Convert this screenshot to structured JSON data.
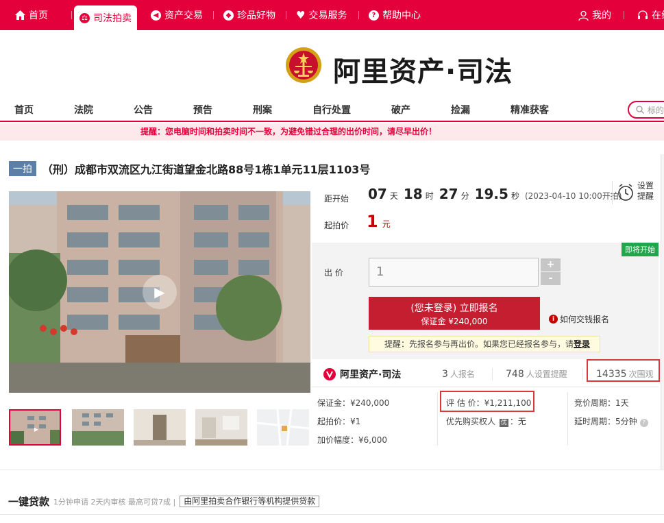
{
  "topbar": {
    "items": [
      {
        "label": "首页",
        "icon": "home-icon"
      },
      {
        "label": "司法拍卖",
        "icon": "gavel-icon"
      },
      {
        "label": "资产交易",
        "icon": "compass-icon"
      },
      {
        "label": "珍品好物",
        "icon": "gem-icon"
      },
      {
        "label": "交易服务",
        "icon": "heart-icon"
      },
      {
        "label": "帮助中心",
        "icon": "question-icon"
      }
    ],
    "mine": "我的",
    "online": "在线"
  },
  "logo": {
    "text": "阿里资产·司法"
  },
  "nav": {
    "items": [
      "首页",
      "法院",
      "公告",
      "预告",
      "刑案",
      "自行处置",
      "破产",
      "捡漏",
      "精准获客"
    ],
    "search_placeholder": "标的"
  },
  "notice": "提醒：您电脑时间和拍卖时间不一致，为避免错过合理的出价时间，请尽早出价！",
  "lot": {
    "tag": "一拍",
    "title": "（刑）成都市双流区九江街道望金北路88号1栋1单元11层1103号"
  },
  "countdown": {
    "label": "距开始",
    "days": "07",
    "days_unit": "天",
    "hours": "18",
    "hours_unit": "时",
    "minutes": "27",
    "minutes_unit": "分",
    "seconds": "19.5",
    "seconds_unit": "秒",
    "start": "(2023-04-10 10:00开拍)"
  },
  "remind": {
    "line1": "设置",
    "line2": "提醒"
  },
  "start_price": {
    "label": "起拍价",
    "value": "1",
    "unit": "元"
  },
  "bid": {
    "badge": "即将开始",
    "label": "出 价",
    "input_value": "1",
    "plus": "+",
    "minus": "-",
    "signup_main": "(您未登录) 立即报名",
    "signup_sub": "保证金 ¥240,000",
    "howto": "如何交钱报名",
    "tip_prefix": "提醒：先报名参与再出价。如果您已经报名参与，请",
    "tip_link": "登录"
  },
  "stats": {
    "brand": "阿里资产·司法",
    "signups": "3",
    "signups_label": "人报名",
    "reminders": "748",
    "reminders_label": "人设置提醒",
    "views": "14335",
    "views_label": "次围观"
  },
  "details": {
    "deposit": "保证金：¥240,000",
    "start_price": "起拍价：¥1",
    "increment": "加价幅度：¥6,000",
    "appraisal": "评 估 价：¥1,211,100",
    "priority_label": "优先购买权人",
    "priority_badge": "优",
    "priority_value": "：无",
    "cycle": "竞价周期：1天",
    "delay": "延时周期：5分钟"
  },
  "loan": {
    "title": "一键贷款",
    "sub": "1分钟申请 2天内审核 最高可贷7成 |",
    "badge": "由阿里拍卖合作银行等机构提供贷款"
  },
  "colors": {
    "brand": "#e4003a",
    "price": "#c40000",
    "signup": "#c51e31",
    "tag": "#5d7fa7",
    "soon": "#22a64c"
  }
}
